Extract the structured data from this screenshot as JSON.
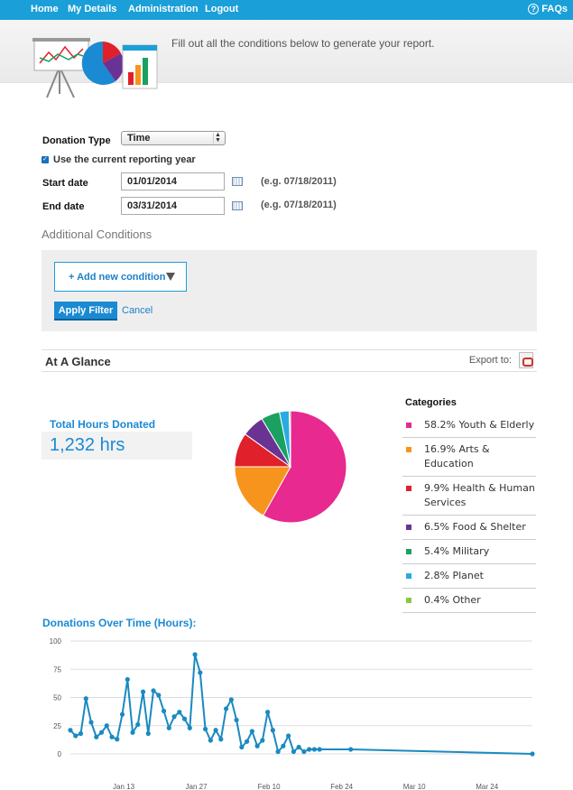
{
  "nav": {
    "home": "Home",
    "details": "My Details",
    "admin": "Administration",
    "logout": "Logout",
    "faqs": "FAQs",
    "faq_glyph": "?"
  },
  "header": {
    "intro": "Fill out all the conditions below to generate your report."
  },
  "form": {
    "donation_type_label": "Donation Type",
    "donation_type_value": "Time",
    "use_current_year": "Use the current reporting year",
    "start_label": "Start date",
    "start_value": "01/01/2014",
    "start_hint": "(e.g. 07/18/2011)",
    "end_label": "End date",
    "end_value": "03/31/2014",
    "end_hint": "(e.g. 07/18/2011)",
    "additional_conditions": "Additional Conditions",
    "add_condition": "+ Add new condition",
    "apply_filter": "Apply Filter",
    "cancel": "Cancel"
  },
  "glance": {
    "title": "At A Glance",
    "export": "Export to:",
    "total_label": "Total Hours Donated",
    "total_value": "1,232 hrs",
    "categories_title": "Categories"
  },
  "categories": [
    {
      "pct": "58.2%",
      "name": "Youth & Elderly",
      "value": 58.2,
      "color": "#e8298f"
    },
    {
      "pct": "16.9%",
      "name": "Arts & Education",
      "value": 16.9,
      "color": "#f7941d"
    },
    {
      "pct": "9.9%",
      "name": "Health & Human Services",
      "value": 9.9,
      "color": "#e0202a"
    },
    {
      "pct": "6.5%",
      "name": "Food & Shelter",
      "value": 6.5,
      "color": "#6a3293"
    },
    {
      "pct": "5.4%",
      "name": "Military",
      "value": 5.4,
      "color": "#1aa060"
    },
    {
      "pct": "2.8%",
      "name": "Planet",
      "value": 2.8,
      "color": "#29abe2"
    },
    {
      "pct": "0.4%",
      "name": "Other",
      "value": 0.4,
      "color": "#8dc63f"
    }
  ],
  "line": {
    "title": "Donations Over Time (Hours):"
  },
  "chart_data": [
    {
      "type": "pie",
      "title": "",
      "categories": [
        "Youth & Elderly",
        "Arts & Education",
        "Health & Human Services",
        "Food & Shelter",
        "Military",
        "Planet",
        "Other"
      ],
      "values": [
        58.2,
        16.9,
        9.9,
        6.5,
        5.4,
        2.8,
        0.4
      ],
      "legend": "right"
    },
    {
      "type": "line",
      "title": "Donations Over Time (Hours):",
      "xlabel": "",
      "ylabel": "",
      "ylim": [
        0,
        100
      ],
      "yticks": [
        "100",
        "75",
        "50",
        "25",
        "0"
      ],
      "xticks": [
        "Jan 13",
        "Jan 27",
        "Feb 10",
        "Feb 24",
        "Mar 10",
        "Mar 24"
      ],
      "grid": true,
      "x": [
        "2014-01-01",
        "2014-01-02",
        "2014-01-03",
        "2014-01-04",
        "2014-01-05",
        "2014-01-06",
        "2014-01-07",
        "2014-01-08",
        "2014-01-09",
        "2014-01-10",
        "2014-01-11",
        "2014-01-12",
        "2014-01-13",
        "2014-01-14",
        "2014-01-15",
        "2014-01-16",
        "2014-01-17",
        "2014-01-18",
        "2014-01-19",
        "2014-01-20",
        "2014-01-21",
        "2014-01-22",
        "2014-01-23",
        "2014-01-24",
        "2014-01-25",
        "2014-01-26",
        "2014-01-27",
        "2014-01-28",
        "2014-01-29",
        "2014-01-30",
        "2014-01-31",
        "2014-02-01",
        "2014-02-02",
        "2014-02-03",
        "2014-02-04",
        "2014-02-05",
        "2014-02-06",
        "2014-02-07",
        "2014-02-08",
        "2014-02-09",
        "2014-02-10",
        "2014-02-11",
        "2014-02-12",
        "2014-02-13",
        "2014-02-14",
        "2014-02-15",
        "2014-02-16",
        "2014-02-17",
        "2014-02-18",
        "2014-02-24",
        "2014-03-31"
      ],
      "series": [
        {
          "values": [
            21,
            16,
            18,
            49,
            28,
            15,
            19,
            25,
            15,
            13,
            35,
            66,
            19,
            26,
            55,
            18,
            56,
            52,
            38,
            23,
            33,
            37,
            31,
            23,
            88,
            72,
            22,
            12,
            21,
            13,
            40,
            48,
            30,
            6,
            11,
            20,
            7,
            12,
            37,
            21,
            2,
            7,
            16,
            2,
            6,
            2,
            4,
            4,
            4,
            4,
            0
          ]
        }
      ]
    }
  ]
}
